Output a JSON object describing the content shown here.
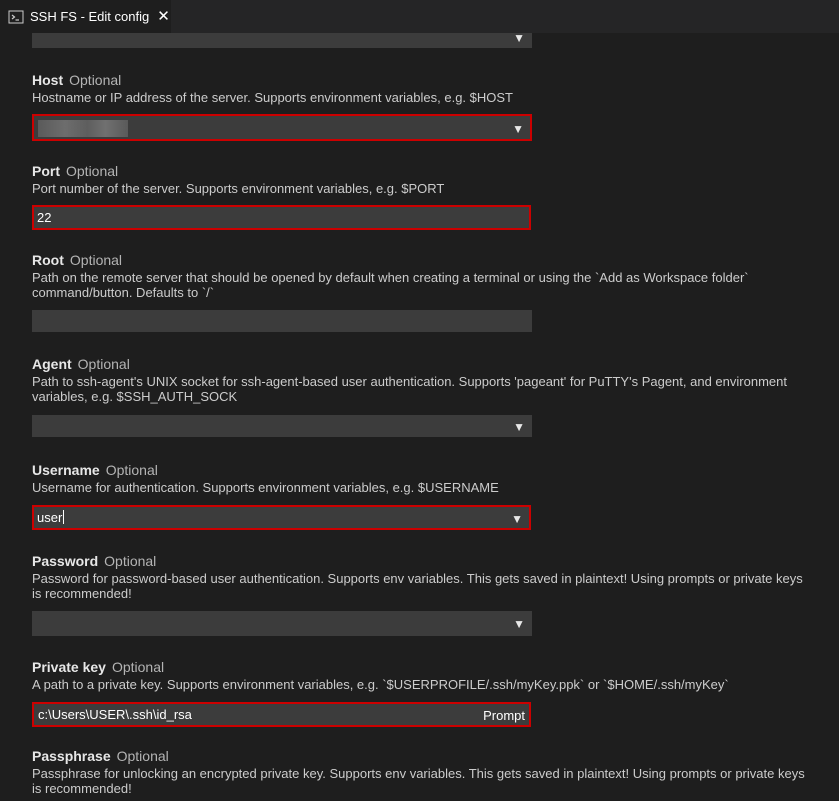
{
  "tab": {
    "title": "SSH FS - Edit config",
    "close_glyph": "✕",
    "icon": "terminal-icon"
  },
  "dropdown_glyph": "▼",
  "fields": {
    "host": {
      "name": "Host",
      "optional": "Optional",
      "desc": "Hostname or IP address of the server. Supports environment variables, e.g. $HOST",
      "value": ""
    },
    "port": {
      "name": "Port",
      "optional": "Optional",
      "desc": "Port number of the server. Supports environment variables, e.g. $PORT",
      "value": "22"
    },
    "root": {
      "name": "Root",
      "optional": "Optional",
      "desc": "Path on the remote server that should be opened by default when creating a terminal or using the `Add as Workspace folder` command/button. Defaults to `/`",
      "value": ""
    },
    "agent": {
      "name": "Agent",
      "optional": "Optional",
      "desc": "Path to ssh-agent's UNIX socket for ssh-agent-based user authentication. Supports 'pageant' for PuTTY's Pagent, and environment variables, e.g. $SSH_AUTH_SOCK",
      "value": ""
    },
    "username": {
      "name": "Username",
      "optional": "Optional",
      "desc": "Username for authentication. Supports environment variables, e.g. $USERNAME",
      "value": "user"
    },
    "password": {
      "name": "Password",
      "optional": "Optional",
      "desc": "Password for password-based user authentication. Supports env variables. This gets saved in plaintext! Using prompts or private keys is recommended!",
      "value": ""
    },
    "private_key": {
      "name": "Private key",
      "optional": "Optional",
      "desc": "A path to a private key. Supports environment variables, e.g. `$USERPROFILE/.ssh/myKey.ppk` or `$HOME/.ssh/myKey`",
      "value": "c:\\Users\\USER\\.ssh\\id_rsa",
      "prompt_label": "Prompt"
    },
    "passphrase": {
      "name": "Passphrase",
      "optional": "Optional",
      "desc": "Passphrase for unlocking an encrypted private key. Supports env variables. This gets saved in plaintext! Using prompts or private keys is recommended!"
    }
  },
  "colors": {
    "background": "#1e1e1e",
    "input": "#3c3c3c",
    "focus_border": "#cc0000"
  }
}
